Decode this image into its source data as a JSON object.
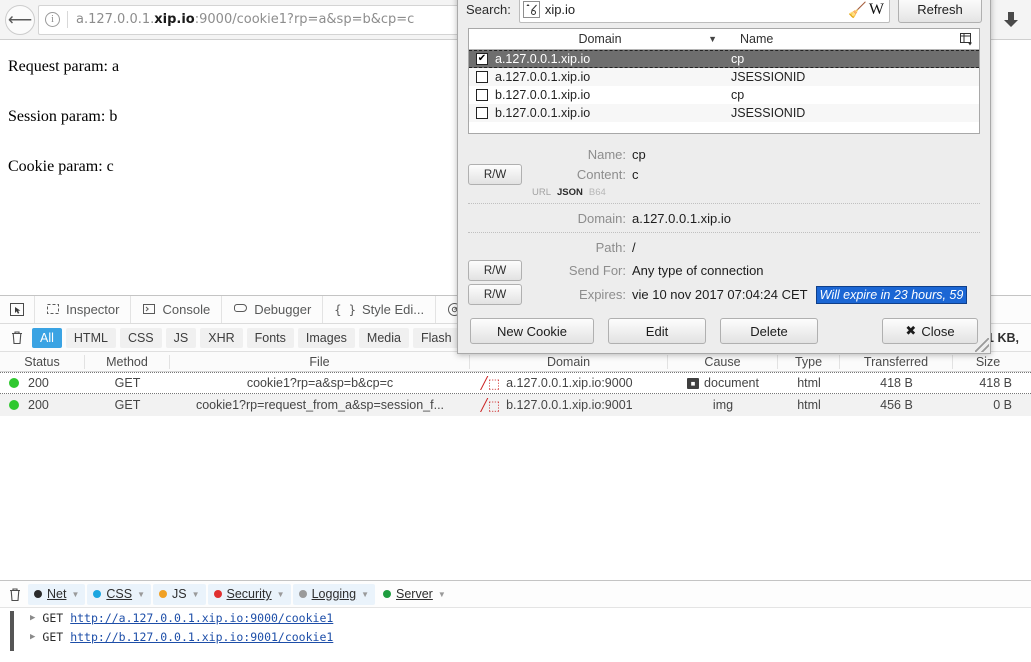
{
  "browser": {
    "back_icon": "back-arrow-icon",
    "info_icon": "info-icon",
    "url_prefix": "a.127.0.0.1.",
    "url_domain": "xip.io",
    "url_suffix": ":9000/cookie1?rp=a&sp=b&cp=c",
    "download_icon": "download-arrow-icon"
  },
  "page": {
    "line1": "Request param: a",
    "line2": "Session param: b",
    "line3": "Cookie param: c"
  },
  "devtools": {
    "picker_icon": "element-picker-icon",
    "tabs": [
      {
        "label": "Inspector",
        "icon": "inspector-icon"
      },
      {
        "label": "Console",
        "icon": "console-icon"
      },
      {
        "label": "Debugger",
        "icon": "debugger-icon"
      },
      {
        "label": "Style Edi...",
        "icon": "style-editor-icon"
      }
    ],
    "performance_icon": "performance-icon",
    "clear_icon": "trash-icon",
    "filters": [
      "All",
      "HTML",
      "CSS",
      "JS",
      "XHR",
      "Fonts",
      "Images",
      "Media",
      "Flash"
    ],
    "active_filter": "All",
    "active_filter_color": "#3aa3e3",
    "summary": "1 KB,",
    "table": {
      "columns": [
        "Status",
        "Method",
        "File",
        "Domain",
        "Cause",
        "Type",
        "Transferred",
        "Size"
      ],
      "rows": [
        {
          "status": "200",
          "status_color": "#2fc82f",
          "method": "GET",
          "file": "cookie1?rp=a&sp=b&cp=c",
          "domain": "a.127.0.0.1.xip.io:9000",
          "domain_icon": "blocked-icon",
          "cause": "document",
          "cause_icon": "document-badge-icon",
          "type": "html",
          "transferred": "418 B",
          "size": "418 B"
        },
        {
          "status": "200",
          "status_color": "#2fc82f",
          "method": "GET",
          "file": "cookie1?rp=request_from_a&sp=session_f...",
          "domain": "b.127.0.0.1.xip.io:9001",
          "domain_icon": "blocked-icon",
          "cause": "img",
          "cause_icon": "",
          "type": "html",
          "transferred": "456 B",
          "size": "0 B"
        }
      ]
    }
  },
  "console": {
    "clear_icon": "trash-icon",
    "filters": [
      {
        "label": "Net",
        "color": "#2b2b2b"
      },
      {
        "label": "CSS",
        "color": "#1ca6e0"
      },
      {
        "label": "JS",
        "color": "#f0a024"
      },
      {
        "label": "Security",
        "color": "#e03030"
      },
      {
        "label": "Logging",
        "color": "#9a9a9a"
      },
      {
        "label": "Server",
        "color": "#1f9d3f"
      }
    ],
    "entries": [
      {
        "method": "GET",
        "url": "http://a.127.0.0.1.xip.io:9000/cookie1",
        "expand_icon": "triangle-right-icon"
      },
      {
        "method": "GET",
        "url": "http://b.127.0.0.1.xip.io:9001/cookie1",
        "expand_icon": "triangle-right-icon"
      }
    ]
  },
  "cookie_dialog": {
    "search_label": "Search:",
    "search_value": "xip.io",
    "search_placeholder": "",
    "search_icon": "filter-settings-icon",
    "clear_icon": "broom-icon",
    "refresh_label": "Refresh",
    "list": {
      "columns": {
        "domain": "Domain",
        "name": "Name"
      },
      "sort_icon": "chevron-down-icon",
      "columns_icon": "column-picker-icon",
      "rows": [
        {
          "checked": true,
          "check_glyph": "✔",
          "domain": "a.127.0.0.1.xip.io",
          "name": "cp"
        },
        {
          "checked": false,
          "check_glyph": "",
          "domain": "a.127.0.0.1.xip.io",
          "name": "JSESSIONID"
        },
        {
          "checked": false,
          "check_glyph": "",
          "domain": "b.127.0.0.1.xip.io",
          "name": "cp"
        },
        {
          "checked": false,
          "check_glyph": "",
          "domain": "b.127.0.0.1.xip.io",
          "name": "JSESSIONID"
        }
      ]
    },
    "details": {
      "rw_label": "R/W",
      "name_label": "Name:",
      "name_value": "cp",
      "content_label": "Content:",
      "content_value": "c",
      "encodings": {
        "url": "URL",
        "json": "JSON",
        "b64": "B64"
      },
      "domain_label": "Domain:",
      "domain_value": "a.127.0.0.1.xip.io",
      "path_label": "Path:",
      "path_value": "/",
      "sendfor_label": "Send For:",
      "sendfor_value": "Any type of connection",
      "expires_label": "Expires:",
      "expires_value": "vie 10 nov 2017 07:04:24 CET",
      "expires_badge": "Will expire in 23 hours, 59",
      "expires_badge_bg": "#1b66d4"
    },
    "buttons": {
      "new_cookie": "New Cookie",
      "edit": "Edit",
      "delete": "Delete",
      "close": "Close",
      "close_icon": "close-x-icon"
    }
  }
}
